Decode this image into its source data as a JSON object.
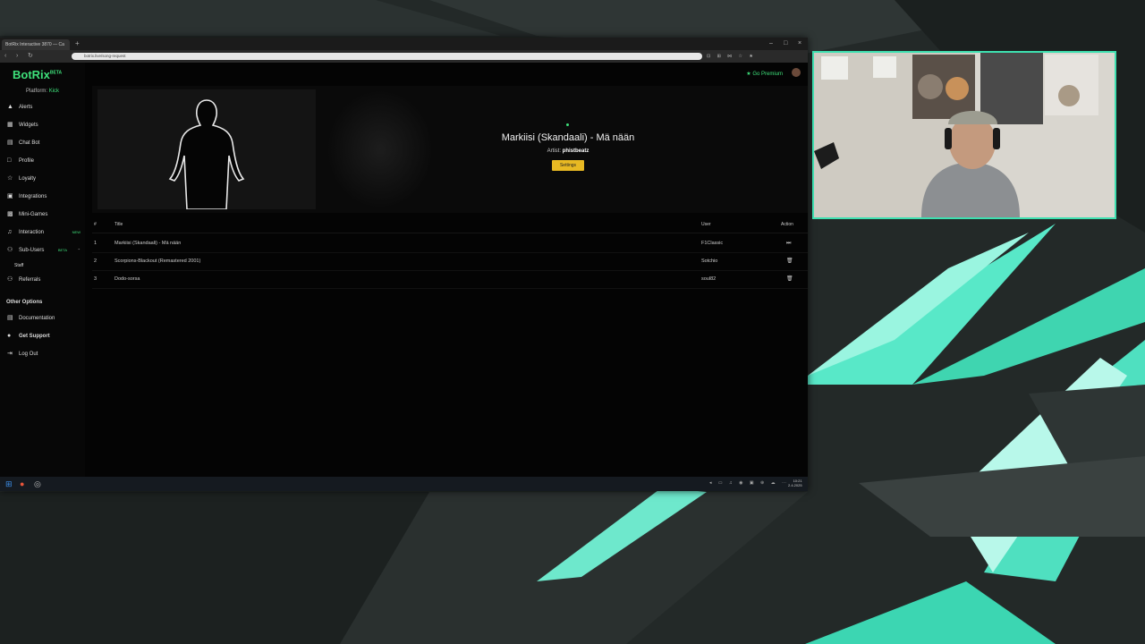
{
  "browser": {
    "tab_title": "BotRix Interactive 3870 — Ca",
    "new_tab": "+",
    "url": "botrix.live/song-request",
    "window_controls": [
      "–",
      "□",
      "×"
    ]
  },
  "brand": {
    "name": "BotRix",
    "badge": "BETA"
  },
  "platform": {
    "label": "Platform:",
    "value": "Kick"
  },
  "sidebar": {
    "items": [
      {
        "label": "Alerts",
        "icon": "bell-icon"
      },
      {
        "label": "Widgets",
        "icon": "widgets-icon"
      },
      {
        "label": "Chat Bot",
        "icon": "chat-icon"
      },
      {
        "label": "Profile",
        "icon": "user-icon"
      },
      {
        "label": "Loyalty",
        "icon": "star-icon"
      },
      {
        "label": "Integrations",
        "icon": "plug-icon"
      },
      {
        "label": "Mini-Games",
        "icon": "gamepad-icon"
      },
      {
        "label": "Interaction",
        "icon": "music-icon",
        "badge": "NEW"
      },
      {
        "label": "Sub-Users",
        "icon": "users-icon",
        "badge": "BETA"
      },
      {
        "label": "Staff"
      },
      {
        "label": "Referrals",
        "icon": "users-icon"
      }
    ],
    "other_title": "Other Options",
    "other_items": [
      {
        "label": "Documentation",
        "icon": "doc-icon"
      },
      {
        "label": "Get Support",
        "icon": "support-icon"
      },
      {
        "label": "Log Out",
        "icon": "logout-icon"
      }
    ]
  },
  "header": {
    "premium_label": "Go Premium"
  },
  "now_playing": {
    "title": "Markiisi (Skandaali) - Mä nään",
    "artist_label": "Artist:",
    "artist": "phistbeatz",
    "settings_button": "Settings"
  },
  "table": {
    "headers": {
      "num": "#",
      "title": "Title",
      "user": "User",
      "action": "Action"
    },
    "rows": [
      {
        "num": "1",
        "title": "Markiisi (Skandaali) - Mä nään",
        "user": "F1Classic",
        "action": "play-icon"
      },
      {
        "num": "2",
        "title": "Scorpions-Blackout (Remastered 2001)",
        "user": "Sotchio",
        "action": "trash-icon"
      },
      {
        "num": "3",
        "title": "Dodo-sorsa",
        "user": "soul82",
        "action": "trash-icon"
      }
    ]
  },
  "taskbar": {
    "time": "10:21",
    "date": "2.4.2025"
  },
  "colors": {
    "accent": "#3ee07a",
    "button": "#e8b923",
    "cam_border": "#3ee0b0"
  }
}
